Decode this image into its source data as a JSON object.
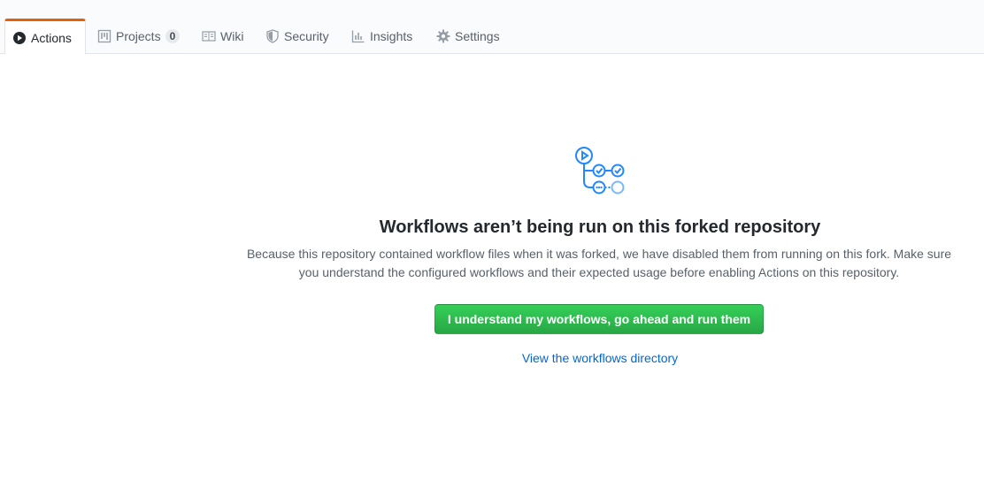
{
  "tabs": [
    {
      "label": "Actions",
      "icon": "play-icon",
      "selected": true
    },
    {
      "label": "Projects",
      "icon": "project-icon",
      "counter": "0"
    },
    {
      "label": "Wiki",
      "icon": "book-icon"
    },
    {
      "label": "Security",
      "icon": "shield-icon"
    },
    {
      "label": "Insights",
      "icon": "graph-icon"
    },
    {
      "label": "Settings",
      "icon": "gear-icon"
    }
  ],
  "notice": {
    "heading": "Workflows aren’t being run on this forked repository",
    "description": "Because this repository contained workflow files when it was forked, we have disabled them from running on this fork. Make sure you understand the configured workflows and their expected usage before enabling Actions on this repository.",
    "run_button": "I understand my workflows, go ahead and run them",
    "directory_link": "View the workflows directory"
  },
  "colors": {
    "accent_tab": "#e36209",
    "button_green": "#28a745",
    "link_blue": "#0366d6",
    "icon_blue": "#2188ff"
  }
}
